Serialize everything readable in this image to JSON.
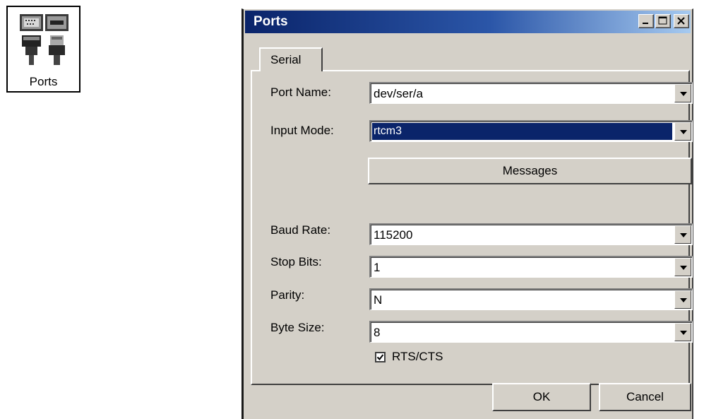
{
  "desktop_icon": {
    "label": "Ports",
    "icon": "ports-icon"
  },
  "window": {
    "title": "Ports",
    "controls": {
      "minimize": "minimize-icon",
      "maximize": "maximize-icon",
      "close": "close-icon"
    },
    "tab": "Serial",
    "fields": {
      "port_name": {
        "label": "Port Name:",
        "value": "dev/ser/a"
      },
      "input_mode": {
        "label": "Input Mode:",
        "value": "rtcm3"
      },
      "baud_rate": {
        "label": "Baud Rate:",
        "value": "115200"
      },
      "stop_bits": {
        "label": "Stop Bits:",
        "value": "1"
      },
      "parity": {
        "label": "Parity:",
        "value": "N"
      },
      "byte_size": {
        "label": "Byte Size:",
        "value": "8"
      }
    },
    "messages_button": "Messages",
    "rts_cts": {
      "label": "RTS/CTS",
      "checked": true
    },
    "ok_button": "OK",
    "cancel_button": "Cancel",
    "colors": {
      "titlebar": "#0a246a",
      "face": "#d4d0c8",
      "selection": "#0a246a"
    }
  }
}
